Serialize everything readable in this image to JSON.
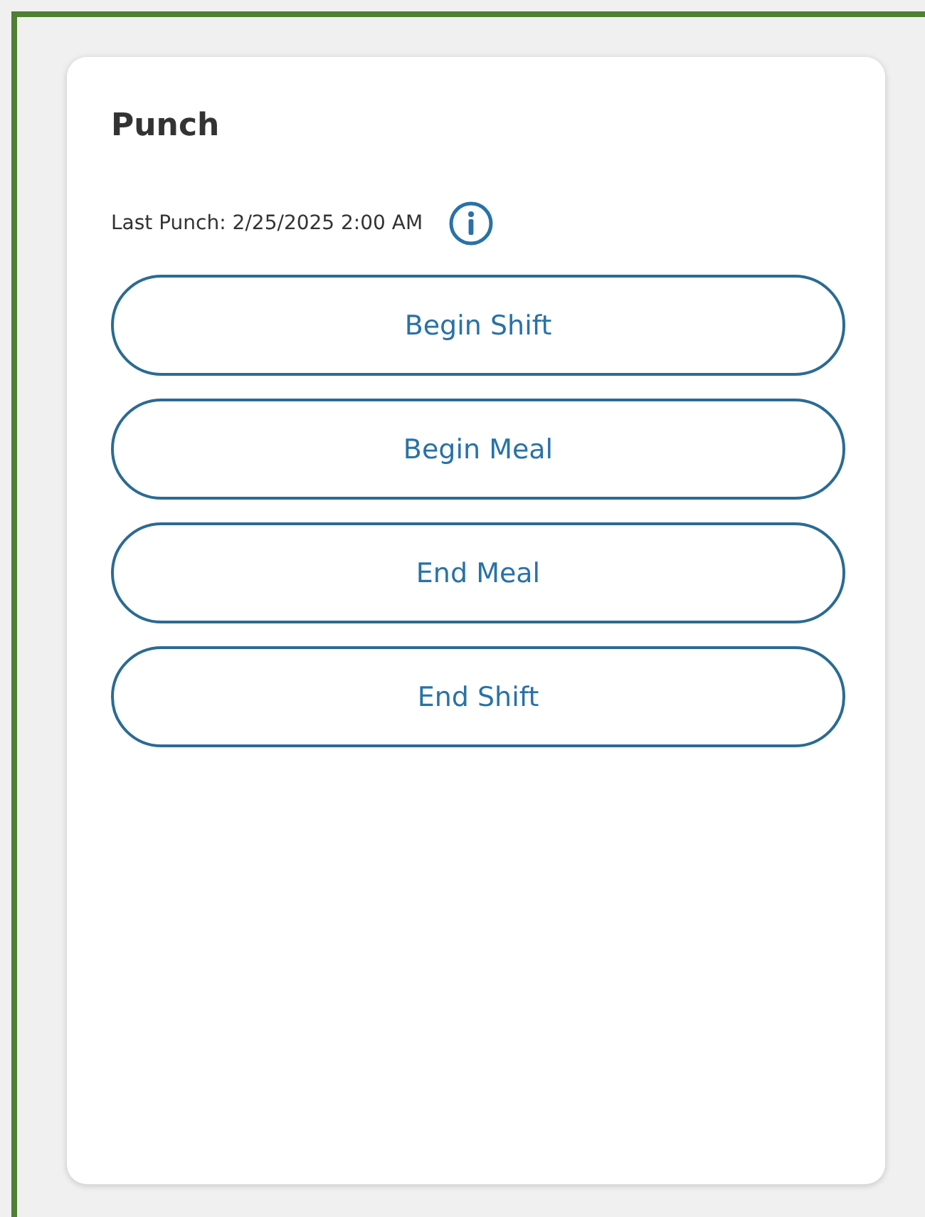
{
  "card": {
    "title": "Punch",
    "last_punch": "Last Punch: 2/25/2025 2:00 AM"
  },
  "buttons": [
    {
      "label": "Begin Shift"
    },
    {
      "label": "Begin Meal"
    },
    {
      "label": "End Meal"
    },
    {
      "label": "End Shift"
    }
  ]
}
